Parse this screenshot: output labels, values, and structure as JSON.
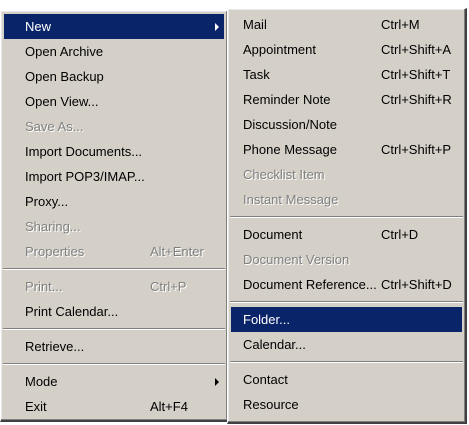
{
  "left_menu": {
    "new": "New",
    "open_archive": "Open Archive",
    "open_backup": "Open Backup",
    "open_view": "Open View...",
    "save_as": "Save As...",
    "import_documents": "Import Documents...",
    "import_pop3_imap": "Import POP3/IMAP...",
    "proxy": "Proxy...",
    "sharing": "Sharing...",
    "properties": "Properties",
    "properties_shortcut": "Alt+Enter",
    "print": "Print...",
    "print_shortcut": "Ctrl+P",
    "print_calendar": "Print Calendar...",
    "retrieve": "Retrieve...",
    "mode": "Mode",
    "exit": "Exit",
    "exit_shortcut": "Alt+F4"
  },
  "right_menu": {
    "mail": "Mail",
    "mail_shortcut": "Ctrl+M",
    "appointment": "Appointment",
    "appointment_shortcut": "Ctrl+Shift+A",
    "task": "Task",
    "task_shortcut": "Ctrl+Shift+T",
    "reminder_note": "Reminder Note",
    "reminder_note_shortcut": "Ctrl+Shift+R",
    "discussion_note": "Discussion/Note",
    "phone_message": "Phone Message",
    "phone_message_shortcut": "Ctrl+Shift+P",
    "checklist_item": "Checklist Item",
    "instant_message": "Instant Message",
    "document": "Document",
    "document_shortcut": "Ctrl+D",
    "document_version": "Document Version",
    "document_reference": "Document Reference...",
    "document_reference_shortcut": "Ctrl+Shift+D",
    "folder": "Folder...",
    "calendar": "Calendar...",
    "contact": "Contact",
    "resource": "Resource"
  },
  "colors": {
    "menu_background": "#d4d0c8",
    "highlight": "#0a246a",
    "disabled_text": "#808080"
  }
}
